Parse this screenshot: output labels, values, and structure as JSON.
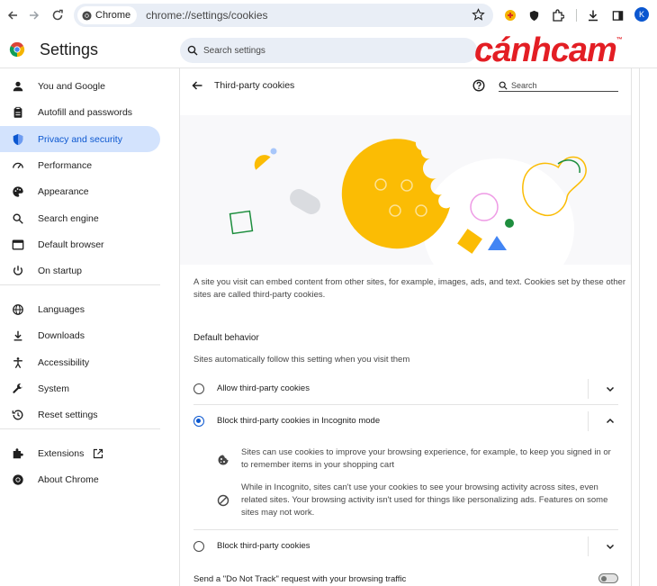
{
  "browser": {
    "chip_label": "Chrome",
    "url": "chrome://settings/cookies",
    "profile_initial": "K"
  },
  "header": {
    "title": "Settings",
    "search_placeholder": "Search settings",
    "brand_text": "cánhcam",
    "brand_mark": "™",
    "brand_color": "#e31e24"
  },
  "sidebar": {
    "items": [
      {
        "label": "You and Google",
        "icon": "person-icon"
      },
      {
        "label": "Autofill and passwords",
        "icon": "clipboard-icon"
      },
      {
        "label": "Privacy and security",
        "icon": "shield-icon",
        "active": true
      },
      {
        "label": "Performance",
        "icon": "speedometer-icon"
      },
      {
        "label": "Appearance",
        "icon": "palette-icon"
      },
      {
        "label": "Search engine",
        "icon": "search-icon"
      },
      {
        "label": "Default browser",
        "icon": "browser-icon"
      },
      {
        "label": "On startup",
        "icon": "power-icon"
      },
      {
        "label": "Languages",
        "icon": "globe-icon"
      },
      {
        "label": "Downloads",
        "icon": "download-icon"
      },
      {
        "label": "Accessibility",
        "icon": "accessibility-icon"
      },
      {
        "label": "System",
        "icon": "wrench-icon"
      },
      {
        "label": "Reset settings",
        "icon": "history-icon"
      },
      {
        "label": "Extensions",
        "icon": "puzzle-icon"
      },
      {
        "label": "About Chrome",
        "icon": "chrome-icon"
      }
    ]
  },
  "page": {
    "title": "Third-party cookies",
    "search_placeholder": "Search",
    "description": "A site you visit can embed content from other sites, for example, images, ads, and text. Cookies set by these other sites are called third-party cookies.",
    "default_behavior_heading": "Default behavior",
    "default_behavior_sub": "Sites automatically follow this setting when you visit them",
    "options": [
      {
        "label": "Allow third-party cookies",
        "selected": false,
        "expanded": false
      },
      {
        "label": "Block third-party cookies in Incognito mode",
        "selected": true,
        "expanded": true
      },
      {
        "label": "Block third-party cookies",
        "selected": false,
        "expanded": false
      }
    ],
    "details": [
      "Sites can use cookies to improve your browsing experience, for example, to keep you signed in or to remember items in your shopping cart",
      "While in Incognito, sites can't use your cookies to see your browsing activity across sites, even related sites. Your browsing activity isn't used for things like personalizing ads. Features on some sites may not work."
    ],
    "dnt_label": "Send a \"Do Not Track\" request with your browsing traffic",
    "dnt_enabled": false
  },
  "colors": {
    "accent": "#0b57d0",
    "active_bg": "#d3e3fd",
    "cookie_yellow": "#fbbc04"
  }
}
